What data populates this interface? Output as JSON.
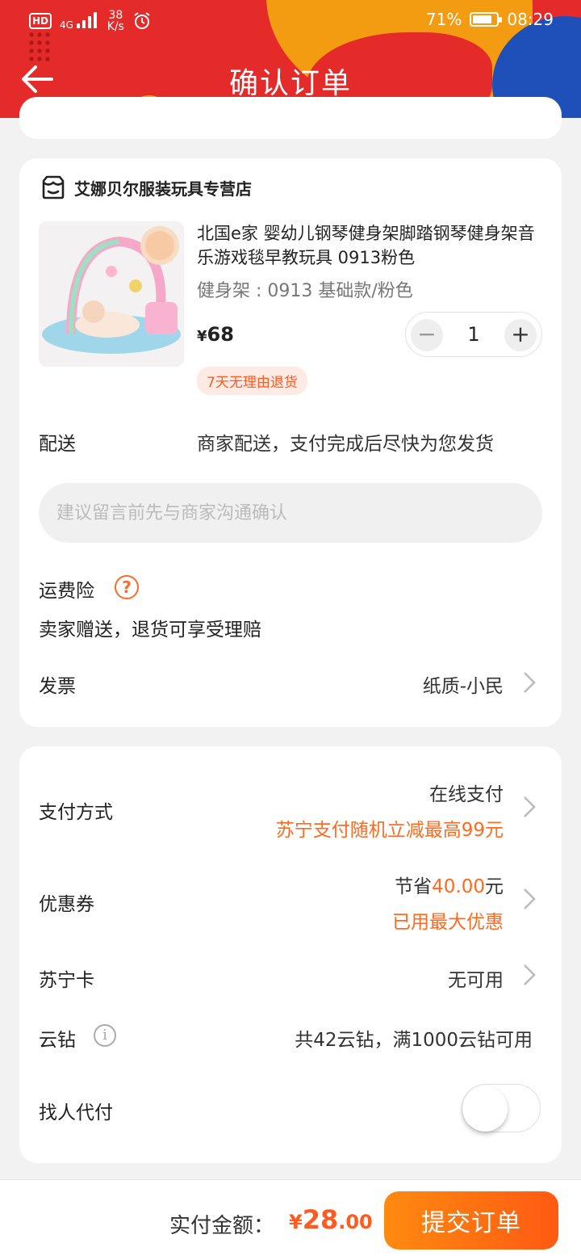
{
  "status_bar": {
    "hd": "HD",
    "network": "4G",
    "speed_value": "38",
    "speed_unit": "K/s",
    "battery": "71%",
    "time": "08:29"
  },
  "nav": {
    "title": "确认订单"
  },
  "store": {
    "name": "艾娜贝尔服装玩具专营店",
    "product": {
      "title": "北国e家 婴幼儿钢琴健身架脚踏钢琴健身架音乐游戏毯早教玩具 0913粉色",
      "spec": "健身架 : 0913 基础款/粉色",
      "currency": "¥",
      "price": "68",
      "quantity": "1",
      "minus": "−",
      "plus": "+",
      "return_tag": "7天无理由退货"
    },
    "delivery": {
      "label": "配送",
      "value": "商家配送，支付完成后尽快为您发货"
    },
    "remark": {
      "placeholder": "建议留言前先与商家沟通确认",
      "value": ""
    },
    "freight_insurance": {
      "label": "运费险",
      "help": "?",
      "desc": "卖家赠送，退货可享受理赔"
    },
    "invoice": {
      "label": "发票",
      "value": "纸质-小民"
    }
  },
  "payment": {
    "method": {
      "label": "支付方式",
      "value": "在线支付",
      "promo": "苏宁支付随机立减最高99元"
    },
    "coupon": {
      "label": "优惠券",
      "save_prefix": "节省",
      "save_amount": "40.00",
      "save_suffix": "元",
      "status": "已用最大优惠"
    },
    "suning_card": {
      "label": "苏宁卡",
      "value": "无可用"
    },
    "cloud_diamond": {
      "label": "云钻",
      "info": "i",
      "value": "共42云钻，满1000云钻可用"
    },
    "find_payer": {
      "label": "找人代付",
      "enabled": false
    }
  },
  "footer": {
    "total_label": "实付金额：",
    "currency": "¥",
    "total_int": "28",
    "total_dec": ".00",
    "submit_label": "提交订单"
  },
  "colors": {
    "accent": "#ff6a1f",
    "header_red": "#e52a2a",
    "header_orange": "#f39c12",
    "header_blue": "#1f4fb8"
  }
}
